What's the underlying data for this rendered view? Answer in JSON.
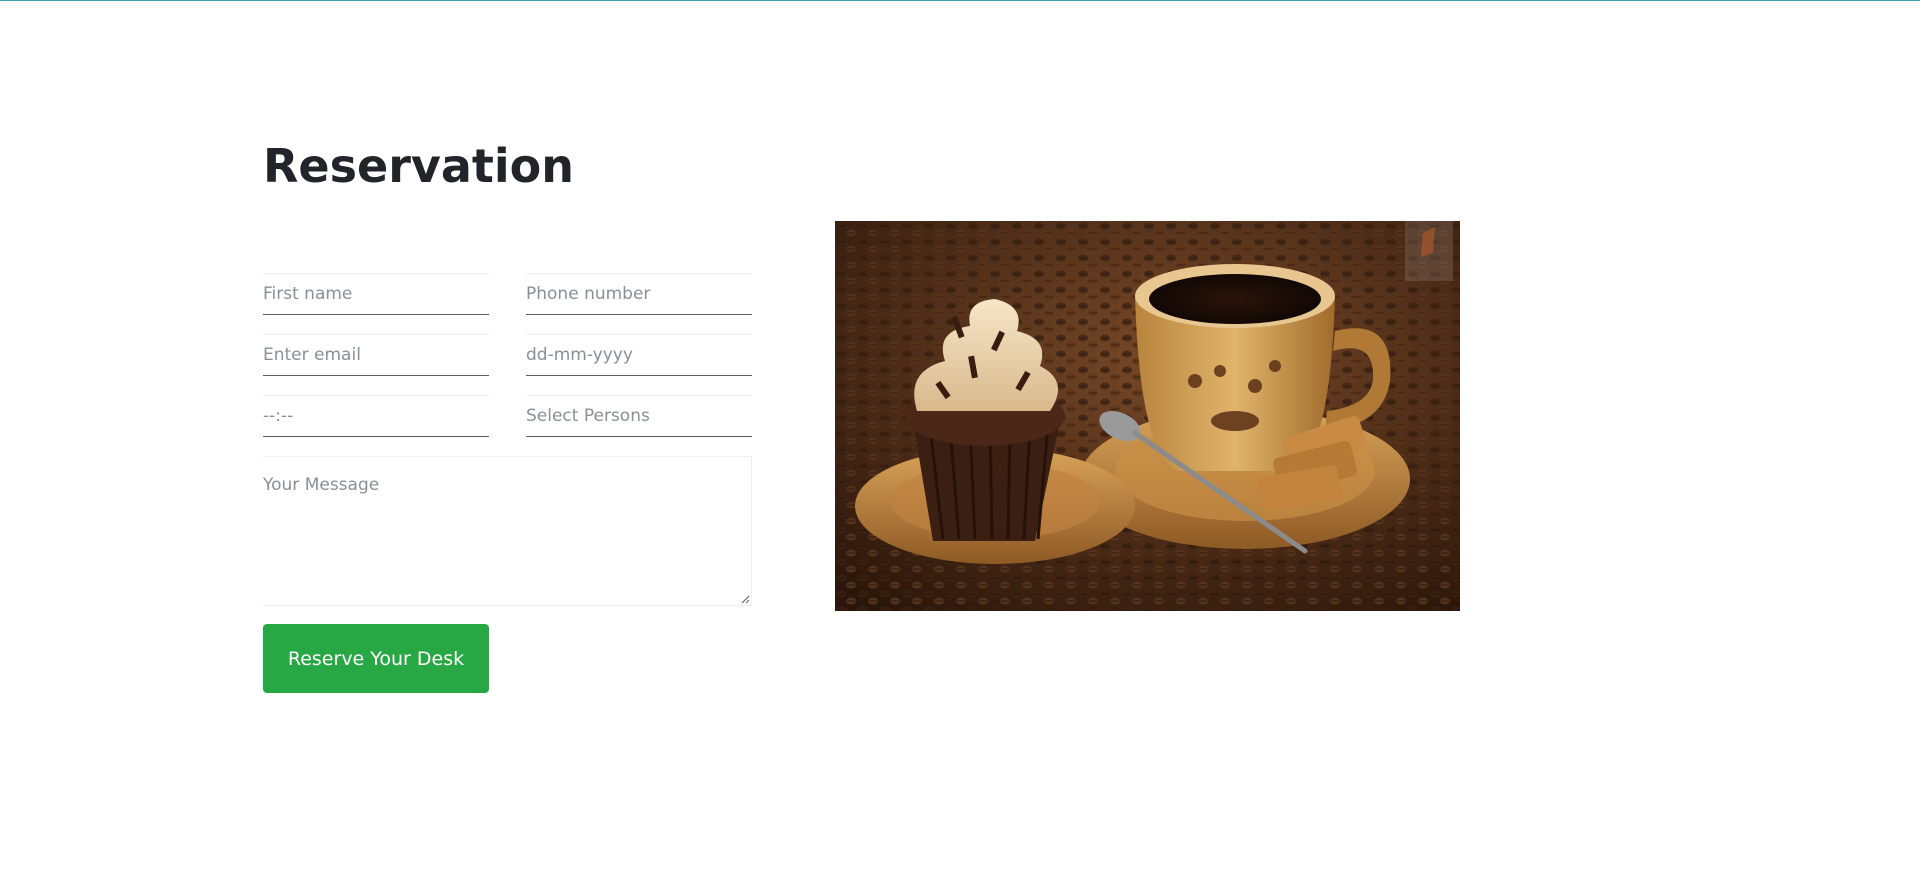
{
  "reservation": {
    "title": "Reservation",
    "fields": {
      "first_name": {
        "placeholder": "First name"
      },
      "phone": {
        "placeholder": "Phone number"
      },
      "email": {
        "placeholder": "Enter email"
      },
      "date": {
        "placeholder": "dd-mm-yyyy"
      },
      "time": {
        "placeholder": "--:--"
      },
      "persons": {
        "placeholder": "Select Persons"
      },
      "message": {
        "placeholder": "Your Message"
      }
    },
    "submit_label": "Reserve Your Desk"
  },
  "colors": {
    "accent_green": "#28a745",
    "top_line": "#3aa6a8",
    "title": "#212529",
    "placeholder": "#8a8f96"
  },
  "image": {
    "subject": "coffee cup, cupcake and biscuits on coffee beans"
  }
}
